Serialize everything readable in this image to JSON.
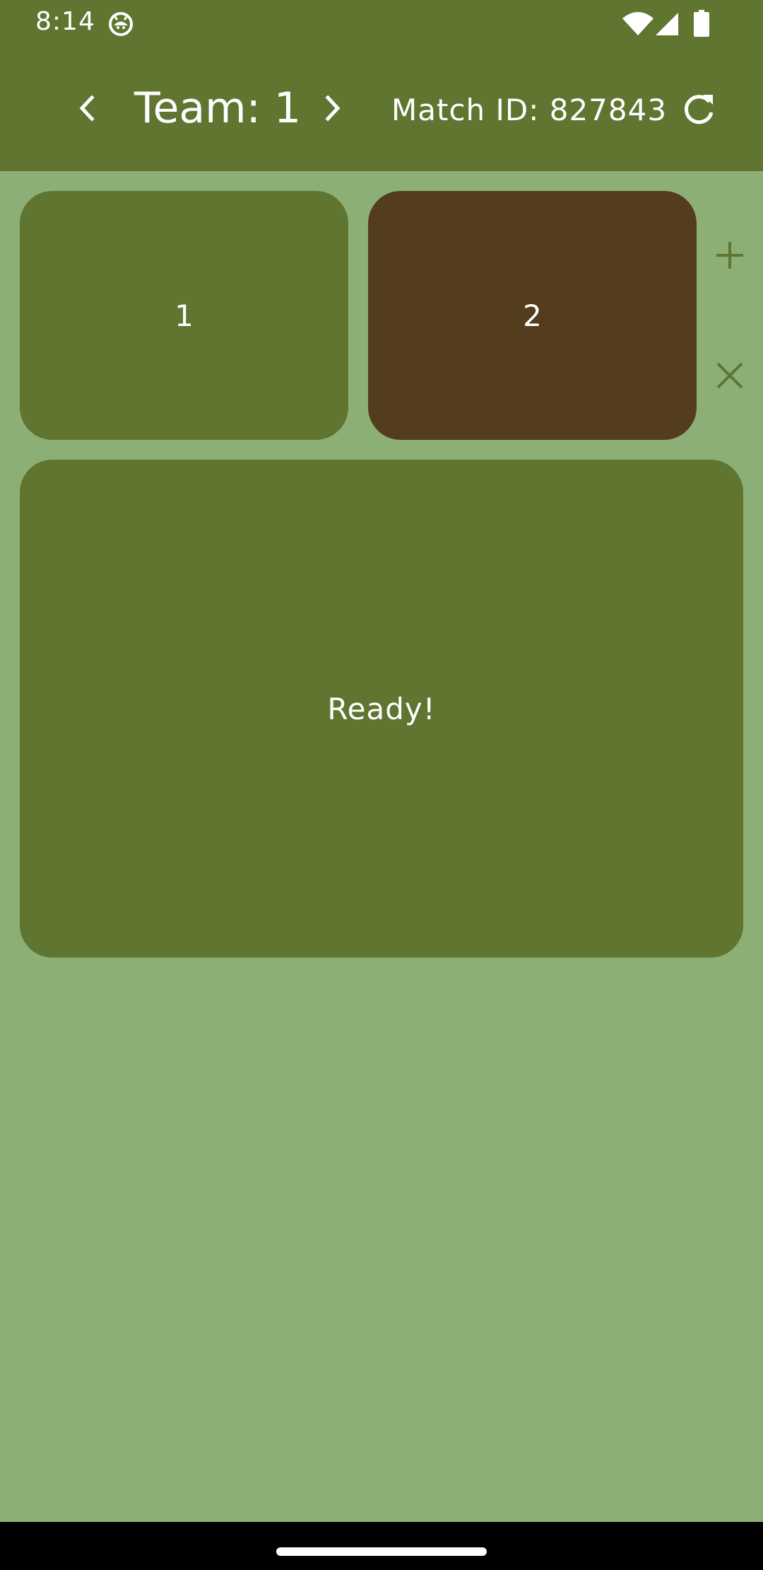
{
  "status_bar": {
    "time": "8:14",
    "app_icon": "android-robot-icon",
    "wifi_icon": "wifi-icon",
    "signal_icon": "cell-signal-icon",
    "battery_icon": "battery-icon"
  },
  "header": {
    "team_label": "Team: 1",
    "match_label": "Match ID: 827843",
    "prev_icon": "chevron-left-icon",
    "next_icon": "chevron-right-icon",
    "refresh_icon": "refresh-icon"
  },
  "robots": [
    {
      "label": "1",
      "color": "#5f7530"
    },
    {
      "label": "2",
      "color": "#543c1f"
    }
  ],
  "actions": {
    "add_icon": "plus-icon",
    "remove_icon": "close-icon"
  },
  "main": {
    "ready_label": "Ready!"
  },
  "colors": {
    "primary": "#5f7530",
    "background": "#8caf75",
    "selected_card": "#543c1f",
    "on_primary": "#ffffff"
  }
}
